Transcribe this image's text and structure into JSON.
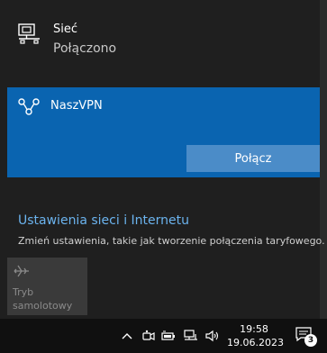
{
  "network": {
    "name": "Sieć",
    "status": "Połączono",
    "icon": "ethernet-icon"
  },
  "vpn": {
    "name": "NaszVPN",
    "icon": "vpn-icon",
    "connect_label": "Połącz",
    "accent": "#0a64b0"
  },
  "settings": {
    "link": "Ustawienia sieci i Internetu",
    "description": "Zmień ustawienia, takie jak tworzenie połączenia taryfowego."
  },
  "quick_actions": {
    "airplane_line1": "Tryb",
    "airplane_line2": "samolotowy",
    "icon": "airplane-icon"
  },
  "taskbar": {
    "time": "19:58",
    "date": "19.06.2023",
    "notification_count": "3",
    "tray_icons": [
      "chevron-up-icon",
      "meet-now-icon",
      "battery-icon",
      "network-icon",
      "volume-icon"
    ]
  }
}
